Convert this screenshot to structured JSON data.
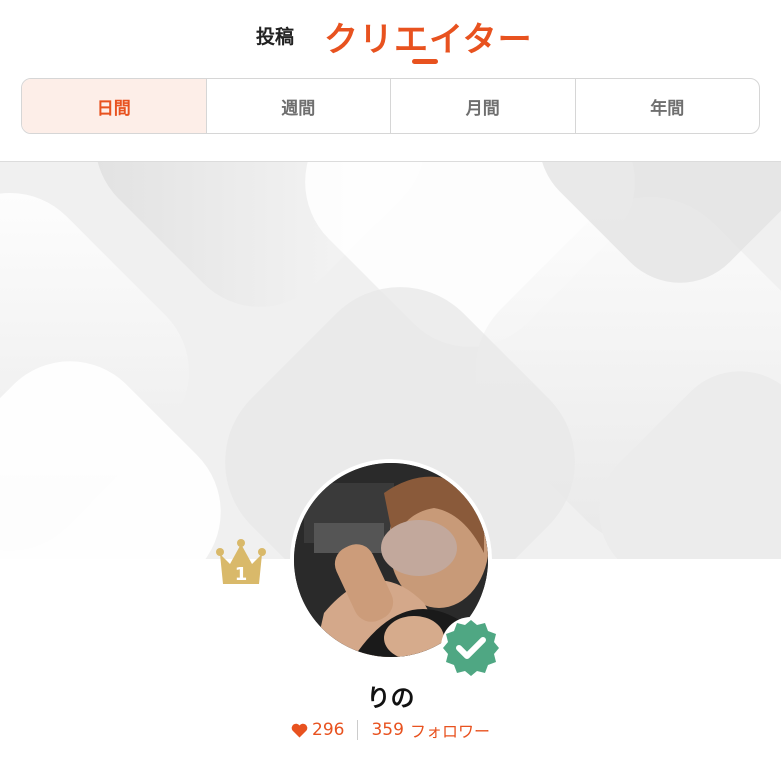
{
  "tabs": {
    "post": "投稿",
    "creator": "クリエイター"
  },
  "period": {
    "items": [
      "日間",
      "週間",
      "月間",
      "年間"
    ],
    "active_index": 0
  },
  "creator": {
    "rank": "1",
    "name": "りの",
    "likes": "296",
    "followers": "359",
    "followers_label": "フォロワー",
    "verified": true
  },
  "colors": {
    "accent": "#e8521f",
    "active_tab_bg": "#fdeee8",
    "crown": "#d9b96a",
    "verified": "#4fa783"
  },
  "icons": [
    "crown-icon",
    "verified-badge-icon",
    "heart-icon"
  ]
}
